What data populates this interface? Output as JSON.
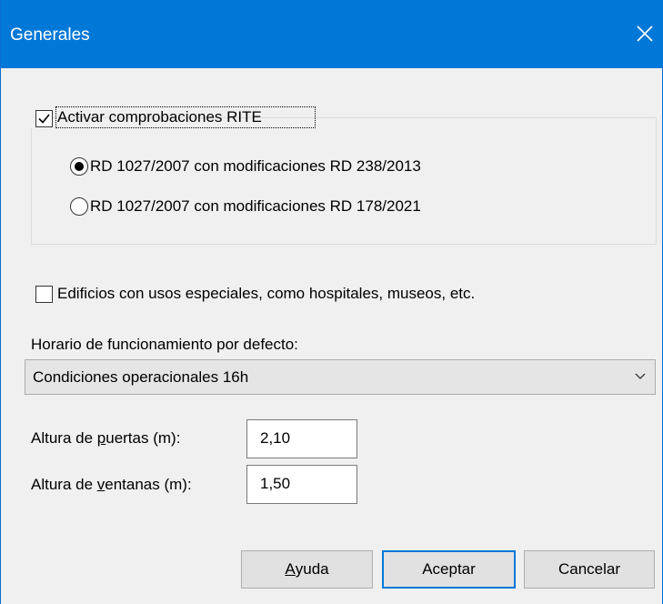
{
  "window": {
    "title": "Generales"
  },
  "rite_group": {
    "checkbox_label": "Activar comprobaciones RITE",
    "checked": true,
    "options": [
      {
        "label": "RD 1027/2007 con modificaciones RD 238/2013",
        "selected": true
      },
      {
        "label": "RD 1027/2007 con modificaciones RD 178/2021",
        "selected": false
      }
    ]
  },
  "special_use": {
    "label": "Edificios con usos especiales, como hospitales, museos, etc.",
    "checked": false
  },
  "schedule": {
    "label": "Horario de funcionamiento por defecto:",
    "selected": "Condiciones operacionales 16h"
  },
  "doors": {
    "label_pre": "Altura de ",
    "label_accel": "p",
    "label_post": "uertas (m):",
    "value": "2,10"
  },
  "windows": {
    "label_pre": "Altura de ",
    "label_accel": "v",
    "label_post": "entanas (m):",
    "value": "1,50"
  },
  "buttons": {
    "help_accel": "A",
    "help_rest": "yuda",
    "accept": "Aceptar",
    "cancel": "Cancelar"
  },
  "colors": {
    "accent": "#0078d7",
    "background": "#f0f0f0"
  },
  "icons": {
    "close": "close-icon",
    "checkmark": "checkmark-icon",
    "dropdown": "chevron-down-icon"
  }
}
